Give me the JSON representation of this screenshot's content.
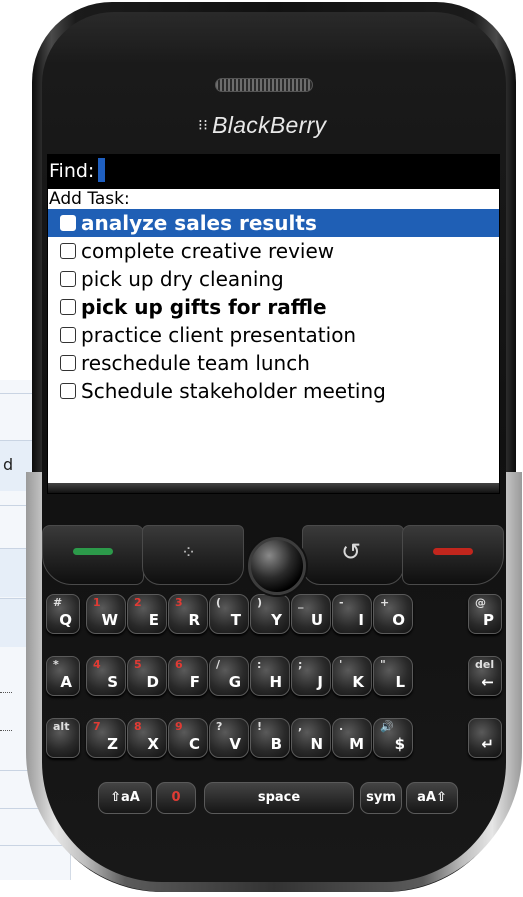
{
  "device": {
    "brand": "BlackBerry",
    "logo_glyph": "⁝⁝"
  },
  "background_app": {
    "partial_letter": "d"
  },
  "screen": {
    "find_label": "Find:",
    "add_task_label": "Add Task:",
    "tasks": [
      {
        "label": "analyze sales results",
        "checked": false,
        "bold": true,
        "selected": true
      },
      {
        "label": "complete creative review",
        "checked": false,
        "bold": false,
        "selected": false
      },
      {
        "label": "pick up dry cleaning",
        "checked": false,
        "bold": false,
        "selected": false
      },
      {
        "label": "pick up gifts for raffle",
        "checked": false,
        "bold": true,
        "selected": false
      },
      {
        "label": "practice client presentation",
        "checked": false,
        "bold": false,
        "selected": false
      },
      {
        "label": "reschedule team lunch",
        "checked": false,
        "bold": false,
        "selected": false
      },
      {
        "label": "Schedule stakeholder meeting",
        "checked": false,
        "bold": false,
        "selected": false
      }
    ],
    "selection_color": "#1f5fb5"
  },
  "nav_keys": {
    "call": {
      "icon": "green-phone-icon",
      "color": "#2c9a4a"
    },
    "menu": {
      "icon": "blackberry-menu-icon",
      "glyph": "⁘"
    },
    "trackball": {
      "icon": "trackball"
    },
    "back": {
      "icon": "back-arrow-icon",
      "glyph": "↺"
    },
    "end": {
      "icon": "red-end-call-icon",
      "color": "#c2261d"
    }
  },
  "keyboard": {
    "rows": [
      [
        {
          "top": "#",
          "main": "Q",
          "top_red": false
        },
        {
          "top": "1",
          "main": "W",
          "top_red": true
        },
        {
          "top": "2",
          "main": "E",
          "top_red": true
        },
        {
          "top": "3",
          "main": "R",
          "top_red": true
        },
        {
          "top": "(",
          "main": "T",
          "top_red": false
        },
        {
          "top": ")",
          "main": "Y",
          "top_red": false
        },
        {
          "top": "_",
          "main": "U",
          "top_red": false
        },
        {
          "top": "-",
          "main": "I",
          "top_red": false
        },
        {
          "top": "+",
          "main": "O",
          "top_red": false
        },
        {
          "top": "@",
          "main": "P",
          "top_red": false
        }
      ],
      [
        {
          "top": "*",
          "main": "A",
          "top_red": false
        },
        {
          "top": "4",
          "main": "S",
          "top_red": true
        },
        {
          "top": "5",
          "main": "D",
          "top_red": true
        },
        {
          "top": "6",
          "main": "F",
          "top_red": true
        },
        {
          "top": "/",
          "main": "G",
          "top_red": false
        },
        {
          "top": ":",
          "main": "H",
          "top_red": false
        },
        {
          "top": ";",
          "main": "J",
          "top_red": false
        },
        {
          "top": "'",
          "main": "K",
          "top_red": false
        },
        {
          "top": "\"",
          "main": "L",
          "top_red": false
        },
        {
          "top": "del",
          "main": "←",
          "top_red": false
        }
      ],
      [
        {
          "top": "alt",
          "main": "",
          "top_red": false
        },
        {
          "top": "7",
          "main": "Z",
          "top_red": true
        },
        {
          "top": "8",
          "main": "X",
          "top_red": true
        },
        {
          "top": "9",
          "main": "C",
          "top_red": true
        },
        {
          "top": "?",
          "main": "V",
          "top_red": false
        },
        {
          "top": "!",
          "main": "B",
          "top_red": false
        },
        {
          "top": ",",
          "main": "N",
          "top_red": false
        },
        {
          "top": ".",
          "main": "M",
          "top_red": false
        },
        {
          "top": "🔊",
          "main": "$",
          "top_red": true
        },
        {
          "top": "",
          "main": "↵",
          "top_red": false
        }
      ]
    ],
    "bottom_row": {
      "shift_left": "⇧aA",
      "zero": "0",
      "space": "space",
      "sym": "sym",
      "shift_right": "aA⇧"
    }
  }
}
